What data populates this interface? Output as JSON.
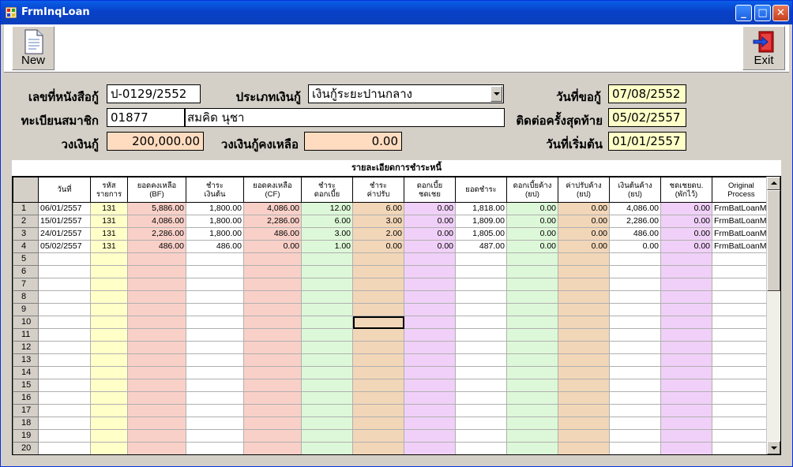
{
  "window": {
    "title": "FrmInqLoan"
  },
  "toolbar": {
    "new_label": "New",
    "exit_label": "Exit"
  },
  "form": {
    "contract_no_label": "เลขที่หนังสือกู้",
    "contract_no_value": "ป-0129/2552",
    "loan_type_label": "ประเภทเงินกู้",
    "loan_type_value": "เงินกู้ระยะปานกลาง",
    "request_date_label": "วันที่ขอกู้",
    "request_date_value": "07/08/2552",
    "member_no_label": "ทะเบียนสมาชิก",
    "member_no_value": "01877",
    "member_name_value": "สมคิด  นุชา",
    "last_contact_label": "ติดต่อครั้งสุดท้าย",
    "last_contact_value": "05/02/2557",
    "loan_amount_label": "วงเงินกู้",
    "loan_amount_value": "200,000.00",
    "loan_remaining_label": "วงเงินกู้คงเหลือ",
    "loan_remaining_value": "0.00",
    "start_date_label": "วันที่เริ่มต้น",
    "start_date_value": "01/01/2557"
  },
  "grid": {
    "title": "รายละเอียดการชำระหนี้",
    "headers": [
      {
        "l1": "วันที่",
        "l2": ""
      },
      {
        "l1": "รหัส",
        "l2": "รายการ"
      },
      {
        "l1": "ยอดคงเหลือ",
        "l2": "(BF)"
      },
      {
        "l1": "ชำระ",
        "l2": "เงินต้น"
      },
      {
        "l1": "ยอดคงเหลือ",
        "l2": "(CF)"
      },
      {
        "l1": "ชำระ",
        "l2": "ดอกเบี้ย"
      },
      {
        "l1": "ชำระ",
        "l2": "ค่าปรับ"
      },
      {
        "l1": "ดอกเบี้ย",
        "l2": "ชดเชย"
      },
      {
        "l1": "ยอดชำระ",
        "l2": ""
      },
      {
        "l1": "ดอกเบี้ยค้าง",
        "l2": "(ยป)"
      },
      {
        "l1": "ค่าปรับค้าง",
        "l2": "(ยป)"
      },
      {
        "l1": "เงินต้นค้าง",
        "l2": "(ยป)"
      },
      {
        "l1": "ชดเชยดบ.",
        "l2": "(พักไว้)"
      },
      {
        "l1": "Original",
        "l2": "Process"
      }
    ],
    "rows": [
      [
        "06/01/2557",
        "131",
        "5,886.00",
        "1,800.00",
        "4,086.00",
        "12.00",
        "6.00",
        "0.00",
        "1,818.00",
        "0.00",
        "0.00",
        "4,086.00",
        "0.00",
        "FrmBatLoanMi"
      ],
      [
        "15/01/2557",
        "131",
        "4,086.00",
        "1,800.00",
        "2,286.00",
        "6.00",
        "3.00",
        "0.00",
        "1,809.00",
        "0.00",
        "0.00",
        "2,286.00",
        "0.00",
        "FrmBatLoanMi"
      ],
      [
        "24/01/2557",
        "131",
        "2,286.00",
        "1,800.00",
        "486.00",
        "3.00",
        "2.00",
        "0.00",
        "1,805.00",
        "0.00",
        "0.00",
        "486.00",
        "0.00",
        "FrmBatLoanMi"
      ],
      [
        "05/02/2557",
        "131",
        "486.00",
        "486.00",
        "0.00",
        "1.00",
        "0.00",
        "0.00",
        "487.00",
        "0.00",
        "0.00",
        "0.00",
        "0.00",
        "FrmBatLoanMi"
      ]
    ],
    "row_numbers": [
      "1",
      "2",
      "3",
      "4",
      "5",
      "6",
      "7",
      "8",
      "9",
      "10",
      "11",
      "12",
      "13",
      "14",
      "15",
      "16",
      "17",
      "18",
      "19",
      "20"
    ]
  }
}
